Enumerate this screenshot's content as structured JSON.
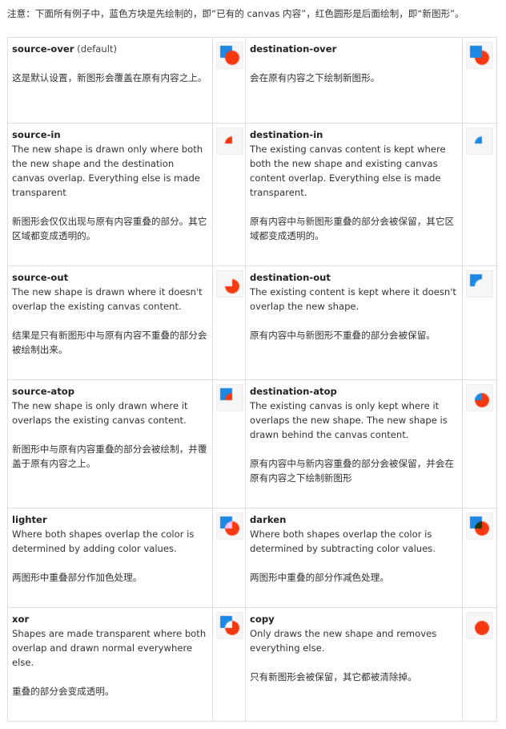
{
  "note": "注意：下面所有例子中，蓝色方块是先绘制的，即“已有的 canvas 内容”，红色圆形是后面绘制，即“新图形”。",
  "colors": {
    "blue": "#1e88e5",
    "red": "#f4380f",
    "bg": "#f6f6f6",
    "border": "#dddddd"
  },
  "rows": [
    {
      "left": {
        "name": "source-over",
        "extra": " (default)",
        "en": "",
        "zh": "这是默认设置，新图形会覆盖在原有内容之上。",
        "op": "source-over"
      },
      "right": {
        "name": "destination-over",
        "extra": "",
        "en": "",
        "zh": "会在原有内容之下绘制新图形。",
        "op": "destination-over"
      }
    },
    {
      "left": {
        "name": "source-in",
        "extra": "",
        "en": "The new shape is drawn only where both the new shape and the destination canvas overlap. Everything else is made transparent",
        "zh": "新图形会仅仅出现与原有内容重叠的部分。其它区域都变成透明的。",
        "op": "source-in"
      },
      "right": {
        "name": "destination-in",
        "extra": "",
        "en": "The existing canvas content is kept where both the new shape and existing canvas content overlap. Everything else is made transparent.",
        "zh": "原有内容中与新图形重叠的部分会被保留，其它区域都变成透明的。",
        "op": "destination-in"
      }
    },
    {
      "left": {
        "name": "source-out",
        "extra": "",
        "en": "The new shape is drawn where it doesn't overlap the existing canvas content.",
        "zh": "结果是只有新图形中与原有内容不重叠的部分会被绘制出来。",
        "op": "source-out"
      },
      "right": {
        "name": "destination-out",
        "extra": "",
        "en": "The existing content is kept where it doesn't overlap the new shape.",
        "zh": "原有内容中与新图形不重叠的部分会被保留。",
        "op": "destination-out"
      }
    },
    {
      "left": {
        "name": "source-atop",
        "extra": "",
        "en": "The new shape is only drawn where it overlaps the existing canvas content.",
        "zh": "新图形中与原有内容重叠的部分会被绘制，并覆盖于原有内容之上。",
        "op": "source-atop"
      },
      "right": {
        "name": "destination-atop",
        "extra": "",
        "en": "The existing canvas is only kept where it overlaps the new shape. The new shape is drawn behind the canvas content.",
        "zh": "原有内容中与新内容重叠的部分会被保留，并会在原有内容之下绘制新图形",
        "op": "destination-atop"
      }
    },
    {
      "left": {
        "name": "lighter",
        "extra": "",
        "en": "Where both shapes overlap the color is determined by adding color values.",
        "zh": "两图形中重叠部分作加色处理。",
        "op": "lighter"
      },
      "right": {
        "name": "darken",
        "extra": "",
        "en": "Where both shapes overlap the color is determined by subtracting color values.",
        "zh": "两图形中重叠的部分作减色处理。",
        "op": "darken"
      }
    },
    {
      "left": {
        "name": "xor",
        "extra": "",
        "en": "Shapes are made transparent where both overlap and drawn normal everywhere else.",
        "zh": "重叠的部分会变成透明。",
        "op": "xor"
      },
      "right": {
        "name": "copy",
        "extra": "",
        "en": "Only draws the new shape and removes everything else.",
        "zh": "只有新图形会被保留，其它都被清除掉。",
        "op": "copy"
      }
    }
  ]
}
